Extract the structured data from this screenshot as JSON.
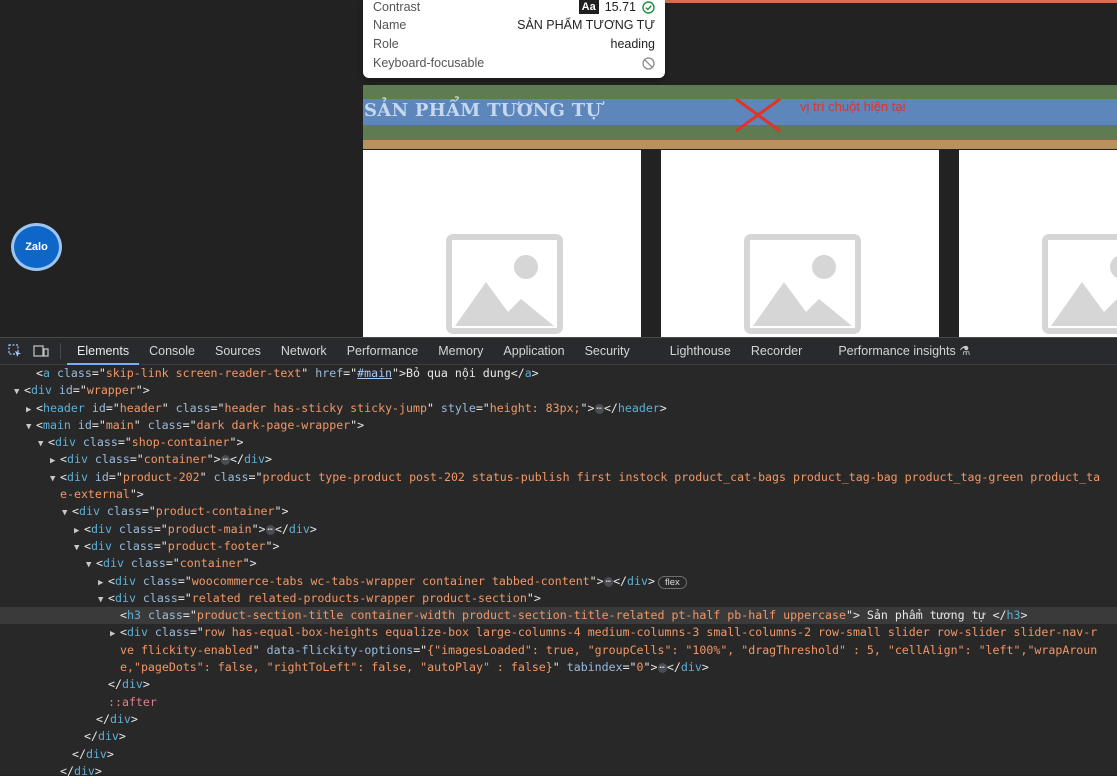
{
  "tooltip": {
    "rows": [
      {
        "label": "Contrast",
        "value": "15.71"
      },
      {
        "label": "Name",
        "value": "SẢN PHẨM TƯƠNG TỰ"
      },
      {
        "label": "Role",
        "value": "heading"
      },
      {
        "label": "Keyboard-focusable",
        "value": ""
      }
    ],
    "aa_badge": "Aa"
  },
  "page": {
    "section_title": "SẢN PHẨM TƯƠNG TỰ",
    "cursor_note": "vị trí chuột hiện tại",
    "zalo_label": "Zalo",
    "colors": {
      "margin": "#5f7b52",
      "content": "#5d86ba",
      "padding": "#b9915d",
      "accent": "#d0714a"
    }
  },
  "devtools": {
    "tabs": [
      "Elements",
      "Console",
      "Sources",
      "Network",
      "Performance",
      "Memory",
      "Application",
      "Security",
      "Lighthouse",
      "Recorder",
      "Performance insights"
    ],
    "lines": [
      {
        "indent": 3,
        "tw": "",
        "parts": [
          [
            "p",
            "<"
          ],
          [
            "t",
            "a"
          ],
          [
            "p",
            " "
          ],
          [
            "n",
            "class"
          ],
          [
            "p",
            "=\""
          ],
          [
            "v",
            "skip-link screen-reader-text"
          ],
          [
            "p",
            "\" "
          ],
          [
            "n",
            "href"
          ],
          [
            "p",
            "=\""
          ],
          [
            "u",
            "#main"
          ],
          [
            "p",
            "\">"
          ],
          [
            "x",
            "Bỏ qua nội dung"
          ],
          [
            "p",
            "</"
          ],
          [
            "t",
            "a"
          ],
          [
            "p",
            ">"
          ]
        ]
      },
      {
        "indent": 2,
        "tw": "▼",
        "parts": [
          [
            "p",
            "<"
          ],
          [
            "t",
            "div"
          ],
          [
            "p",
            " "
          ],
          [
            "n",
            "id"
          ],
          [
            "p",
            "=\""
          ],
          [
            "v",
            "wrapper"
          ],
          [
            "p",
            "\">"
          ]
        ]
      },
      {
        "indent": 3,
        "tw": "▶",
        "parts": [
          [
            "p",
            "<"
          ],
          [
            "t",
            "header"
          ],
          [
            "p",
            " "
          ],
          [
            "n",
            "id"
          ],
          [
            "p",
            "=\""
          ],
          [
            "v",
            "header"
          ],
          [
            "p",
            "\" "
          ],
          [
            "n",
            "class"
          ],
          [
            "p",
            "=\""
          ],
          [
            "v",
            "header has-sticky sticky-jump"
          ],
          [
            "p",
            "\" "
          ],
          [
            "n",
            "style"
          ],
          [
            "p",
            "=\""
          ],
          [
            "v",
            "height: 83px;"
          ],
          [
            "p",
            "\">"
          ],
          [
            "e",
            "⋯"
          ],
          [
            "p",
            "</"
          ],
          [
            "t",
            "header"
          ],
          [
            "p",
            ">"
          ]
        ]
      },
      {
        "indent": 3,
        "tw": "▼",
        "parts": [
          [
            "p",
            "<"
          ],
          [
            "t",
            "main"
          ],
          [
            "p",
            " "
          ],
          [
            "n",
            "id"
          ],
          [
            "p",
            "=\""
          ],
          [
            "v",
            "main"
          ],
          [
            "p",
            "\" "
          ],
          [
            "n",
            "class"
          ],
          [
            "p",
            "=\""
          ],
          [
            "v",
            "dark dark-page-wrapper"
          ],
          [
            "p",
            "\">"
          ]
        ]
      },
      {
        "indent": 4,
        "tw": "▼",
        "parts": [
          [
            "p",
            "<"
          ],
          [
            "t",
            "div"
          ],
          [
            "p",
            " "
          ],
          [
            "n",
            "class"
          ],
          [
            "p",
            "=\""
          ],
          [
            "v",
            "shop-container"
          ],
          [
            "p",
            "\">"
          ]
        ]
      },
      {
        "indent": 5,
        "tw": "▶",
        "parts": [
          [
            "p",
            "<"
          ],
          [
            "t",
            "div"
          ],
          [
            "p",
            " "
          ],
          [
            "n",
            "class"
          ],
          [
            "p",
            "=\""
          ],
          [
            "v",
            "container"
          ],
          [
            "p",
            "\">"
          ],
          [
            "e",
            "⋯"
          ],
          [
            "p",
            "</"
          ],
          [
            "t",
            "div"
          ],
          [
            "p",
            ">"
          ]
        ]
      },
      {
        "indent": 5,
        "tw": "▼",
        "parts": [
          [
            "p",
            "<"
          ],
          [
            "t",
            "div"
          ],
          [
            "p",
            " "
          ],
          [
            "n",
            "id"
          ],
          [
            "p",
            "=\""
          ],
          [
            "v",
            "product-202"
          ],
          [
            "p",
            "\" "
          ],
          [
            "n",
            "class"
          ],
          [
            "p",
            "=\""
          ],
          [
            "v",
            "product type-product post-202 status-publish first instock product_cat-bags product_tag-bag product_tag-green product_ta"
          ]
        ]
      },
      {
        "indent": 5,
        "tw": "",
        "parts": [
          [
            "v",
            "e-external"
          ],
          [
            "p",
            "\">"
          ]
        ]
      },
      {
        "indent": 6,
        "tw": "▼",
        "parts": [
          [
            "p",
            "<"
          ],
          [
            "t",
            "div"
          ],
          [
            "p",
            " "
          ],
          [
            "n",
            "class"
          ],
          [
            "p",
            "=\""
          ],
          [
            "v",
            "product-container"
          ],
          [
            "p",
            "\">"
          ]
        ]
      },
      {
        "indent": 7,
        "tw": "▶",
        "parts": [
          [
            "p",
            "<"
          ],
          [
            "t",
            "div"
          ],
          [
            "p",
            " "
          ],
          [
            "n",
            "class"
          ],
          [
            "p",
            "=\""
          ],
          [
            "v",
            "product-main"
          ],
          [
            "p",
            "\">"
          ],
          [
            "e",
            "⋯"
          ],
          [
            "p",
            "</"
          ],
          [
            "t",
            "div"
          ],
          [
            "p",
            ">"
          ]
        ]
      },
      {
        "indent": 7,
        "tw": "▼",
        "parts": [
          [
            "p",
            "<"
          ],
          [
            "t",
            "div"
          ],
          [
            "p",
            " "
          ],
          [
            "n",
            "class"
          ],
          [
            "p",
            "=\""
          ],
          [
            "v",
            "product-footer"
          ],
          [
            "p",
            "\">"
          ]
        ]
      },
      {
        "indent": 8,
        "tw": "▼",
        "parts": [
          [
            "p",
            "<"
          ],
          [
            "t",
            "div"
          ],
          [
            "p",
            " "
          ],
          [
            "n",
            "class"
          ],
          [
            "p",
            "=\""
          ],
          [
            "v",
            "container"
          ],
          [
            "p",
            "\">"
          ]
        ]
      },
      {
        "indent": 9,
        "tw": "▶",
        "parts": [
          [
            "p",
            "<"
          ],
          [
            "t",
            "div"
          ],
          [
            "p",
            " "
          ],
          [
            "n",
            "class"
          ],
          [
            "p",
            "=\""
          ],
          [
            "v",
            "woocommerce-tabs wc-tabs-wrapper container tabbed-content"
          ],
          [
            "p",
            "\">"
          ],
          [
            "e",
            "⋯"
          ],
          [
            "p",
            "</"
          ],
          [
            "t",
            "div"
          ],
          [
            "p",
            ">"
          ],
          [
            "b",
            "flex"
          ]
        ]
      },
      {
        "indent": 9,
        "tw": "▼",
        "parts": [
          [
            "p",
            "<"
          ],
          [
            "t",
            "div"
          ],
          [
            "p",
            " "
          ],
          [
            "n",
            "class"
          ],
          [
            "p",
            "=\""
          ],
          [
            "v",
            "related related-products-wrapper product-section"
          ],
          [
            "p",
            "\">"
          ]
        ]
      },
      {
        "indent": 10,
        "tw": "",
        "hl": true,
        "parts": [
          [
            "p",
            "<"
          ],
          [
            "t",
            "h3"
          ],
          [
            "p",
            " "
          ],
          [
            "n",
            "class"
          ],
          [
            "p",
            "=\""
          ],
          [
            "v",
            "product-section-title container-width product-section-title-related pt-half pb-half uppercase"
          ],
          [
            "p",
            "\">"
          ],
          [
            "x",
            " Sản phẩm tương tự "
          ],
          [
            "p",
            "</"
          ],
          [
            "t",
            "h3"
          ],
          [
            "p",
            ">"
          ]
        ]
      },
      {
        "indent": 10,
        "tw": "▶",
        "parts": [
          [
            "p",
            "<"
          ],
          [
            "t",
            "div"
          ],
          [
            "p",
            " "
          ],
          [
            "n",
            "class"
          ],
          [
            "p",
            "=\""
          ],
          [
            "v",
            "row has-equal-box-heights equalize-box large-columns-4 medium-columns-3 small-columns-2 row-small slider row-slider slider-nav-r"
          ]
        ]
      },
      {
        "indent": 10,
        "tw": "",
        "parts": [
          [
            "v",
            "ve flickity-enabled"
          ],
          [
            "p",
            "\" "
          ],
          [
            "n",
            "data-flickity-options"
          ],
          [
            "p",
            "=\""
          ],
          [
            "v",
            "{\"imagesLoaded\": true, \"groupCells\": \"100%\", \"dragThreshold\" : 5, \"cellAlign\": \"left\",\"wrapAroun"
          ]
        ]
      },
      {
        "indent": 10,
        "tw": "",
        "parts": [
          [
            "v",
            "e,\"pageDots\": false, \"rightToLeft\": false, \"autoPlay\" : false}"
          ],
          [
            "p",
            "\" "
          ],
          [
            "n",
            "tabindex"
          ],
          [
            "p",
            "=\""
          ],
          [
            "v",
            "0"
          ],
          [
            "p",
            "\">"
          ],
          [
            "e",
            "⋯"
          ],
          [
            "p",
            "</"
          ],
          [
            "t",
            "div"
          ],
          [
            "p",
            ">"
          ]
        ]
      },
      {
        "indent": 9,
        "tw": "",
        "parts": [
          [
            "p",
            "</"
          ],
          [
            "t",
            "div"
          ],
          [
            "p",
            ">"
          ]
        ]
      },
      {
        "indent": 9,
        "tw": "",
        "parts": [
          [
            "s",
            "::after"
          ]
        ]
      },
      {
        "indent": 8,
        "tw": "",
        "parts": [
          [
            "p",
            "</"
          ],
          [
            "t",
            "div"
          ],
          [
            "p",
            ">"
          ]
        ]
      },
      {
        "indent": 7,
        "tw": "",
        "parts": [
          [
            "p",
            "</"
          ],
          [
            "t",
            "div"
          ],
          [
            "p",
            ">"
          ]
        ]
      },
      {
        "indent": 6,
        "tw": "",
        "parts": [
          [
            "p",
            "</"
          ],
          [
            "t",
            "div"
          ],
          [
            "p",
            ">"
          ]
        ]
      },
      {
        "indent": 5,
        "tw": "",
        "parts": [
          [
            "p",
            "</"
          ],
          [
            "t",
            "div"
          ],
          [
            "p",
            ">"
          ]
        ]
      }
    ]
  }
}
